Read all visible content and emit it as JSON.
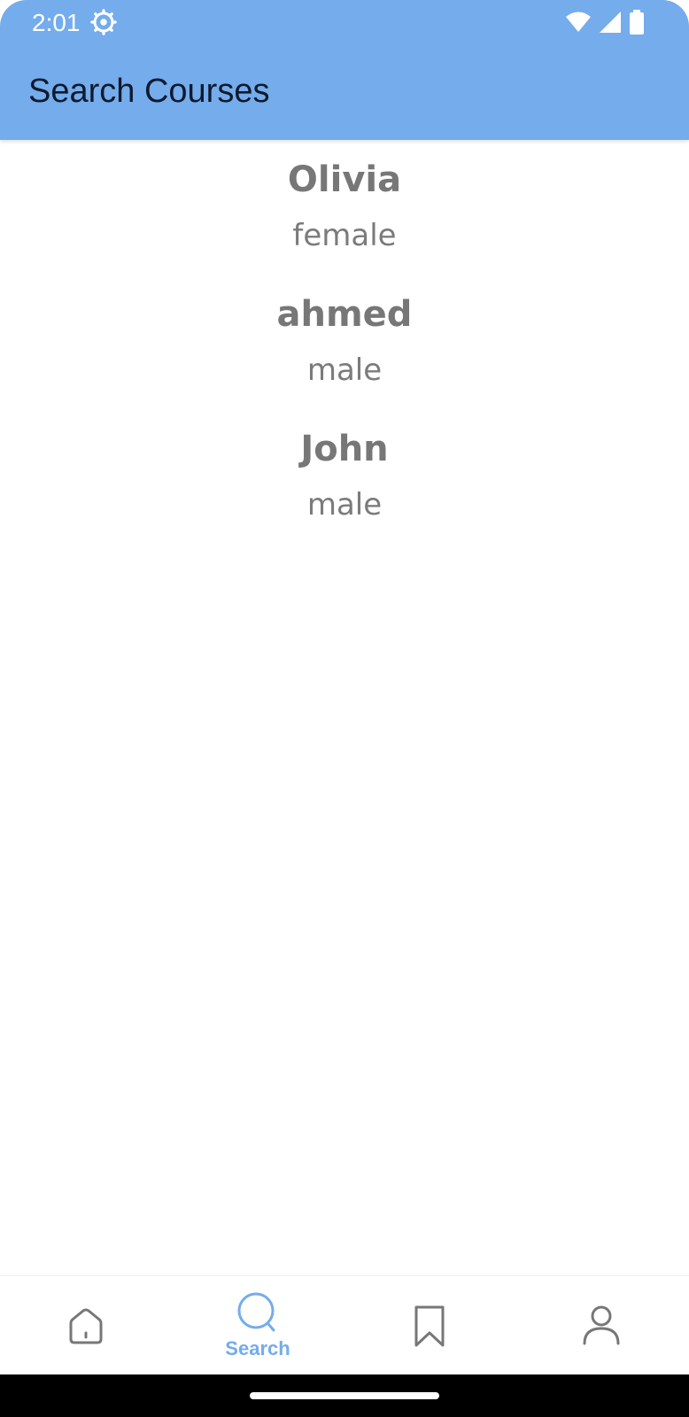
{
  "status_bar": {
    "time": "2:01",
    "icons": [
      "settings-gear-icon",
      "wifi-icon",
      "signal-icon",
      "battery-icon"
    ]
  },
  "app_bar": {
    "title": "Search Courses",
    "background_color": "#74acec"
  },
  "results": [
    {
      "name": "Olivia",
      "gender": "female"
    },
    {
      "name": "ahmed",
      "gender": "male"
    },
    {
      "name": "John",
      "gender": "male"
    }
  ],
  "bottom_nav": {
    "items": [
      {
        "icon": "home-icon",
        "label": "",
        "active": false
      },
      {
        "icon": "search-icon",
        "label": "Search",
        "active": true
      },
      {
        "icon": "bookmark-icon",
        "label": "",
        "active": false
      },
      {
        "icon": "profile-icon",
        "label": "",
        "active": false
      }
    ],
    "active_color": "#74acec"
  }
}
